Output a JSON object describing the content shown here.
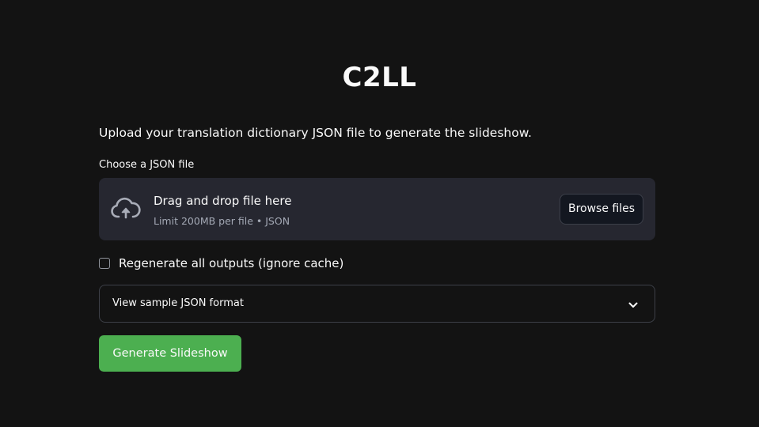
{
  "app": {
    "title": "C2LL"
  },
  "intro": {
    "text": "Upload your translation dictionary JSON file to generate the slideshow."
  },
  "uploader": {
    "label": "Choose a JSON file",
    "drop_text": "Drag and drop file here",
    "limit_text": "Limit 200MB per file • JSON",
    "browse_label": "Browse files",
    "icon": "cloud-upload-icon"
  },
  "options": {
    "regenerate_label": "Regenerate all outputs (ignore cache)",
    "regenerate_checked": false
  },
  "expander": {
    "label": "View sample JSON format",
    "expanded": false,
    "icon": "chevron-down-icon"
  },
  "actions": {
    "generate_label": "Generate Slideshow"
  },
  "colors": {
    "background": "#131313",
    "surface": "#262730",
    "accent_green": "#4caf50",
    "muted_text": "#a3a8b4"
  }
}
